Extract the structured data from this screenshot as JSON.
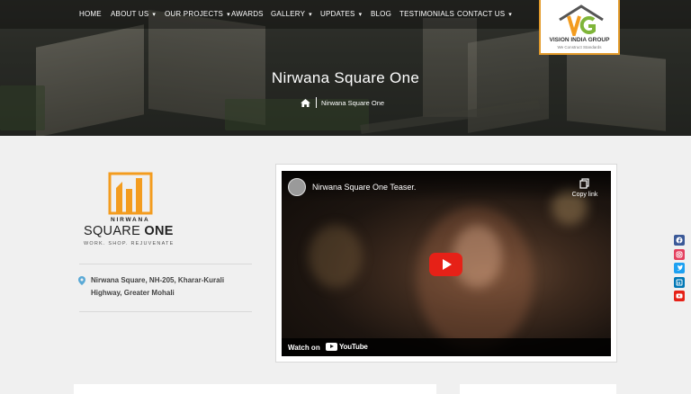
{
  "nav": {
    "items": [
      {
        "label": "HOME",
        "has_dropdown": false
      },
      {
        "label": "ABOUT US",
        "has_dropdown": true
      },
      {
        "label": "OUR PROJECTS",
        "has_dropdown": true
      },
      {
        "label": "AWARDS",
        "has_dropdown": false
      },
      {
        "label": "GALLERY",
        "has_dropdown": true
      },
      {
        "label": "UPDATES",
        "has_dropdown": true
      },
      {
        "label": "BLOG",
        "has_dropdown": false
      },
      {
        "label": "TESTIMONIALS",
        "has_dropdown": false
      },
      {
        "label": "CONTACT US",
        "has_dropdown": true
      }
    ],
    "caret": "▾"
  },
  "logo": {
    "title": "VISION INDIA GROUP",
    "tagline": "We Construct Standards",
    "icon": "house-vg-logo"
  },
  "hero": {
    "title": "Nirwana Square One",
    "breadcrumb_icon": "home-icon",
    "breadcrumb_current": "Nirwana Square One"
  },
  "project": {
    "brand_top": "NIRWANA",
    "brand_main_a": "SQUARE ",
    "brand_main_b": "ONE",
    "brand_tagline": "WORK. SHOP. REJUVENATE",
    "address_line1": "Nirwana Square, NH-205, Kharar-Kurali",
    "address_line2": "Highway, Greater Mohali",
    "address_icon": "map-pin-icon"
  },
  "video": {
    "title": "Nirwana Square One Teaser.",
    "copy_label": "Copy link",
    "watch_on": "Watch on",
    "youtube": "YouTube"
  },
  "social": [
    {
      "icon": "facebook-icon",
      "color": "#3b5998"
    },
    {
      "icon": "instagram-icon",
      "color": "#e4405f"
    },
    {
      "icon": "twitter-icon",
      "color": "#1da1f2"
    },
    {
      "icon": "linkedin-icon",
      "color": "#0077b5"
    },
    {
      "icon": "youtube-icon",
      "color": "#e62117"
    }
  ],
  "colors": {
    "accent": "#e39b2b",
    "logo_orange": "#f39c1f",
    "youtube_red": "#e62117"
  }
}
